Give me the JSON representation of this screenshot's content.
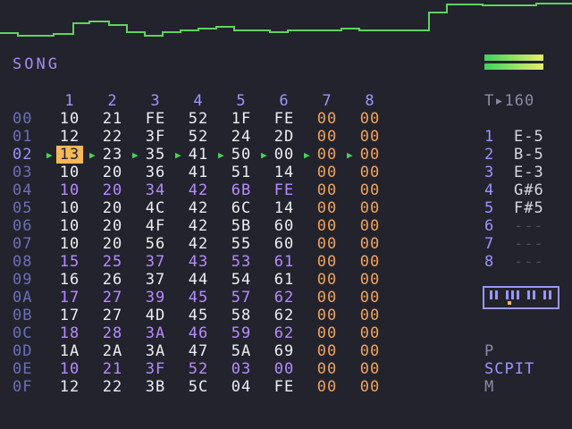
{
  "screen_title": "SONG",
  "columns": [
    "1",
    "2",
    "3",
    "4",
    "5",
    "6",
    "7",
    "8"
  ],
  "rows": [
    {
      "num": "00",
      "cells": [
        "10",
        "21",
        "FE",
        "52",
        "1F",
        "FE",
        "00",
        "00"
      ],
      "color": "white"
    },
    {
      "num": "01",
      "cells": [
        "12",
        "22",
        "3F",
        "52",
        "24",
        "2D",
        "00",
        "00"
      ],
      "color": "white"
    },
    {
      "num": "02",
      "cells": [
        "13",
        "23",
        "35",
        "41",
        "50",
        "00",
        "00",
        "00"
      ],
      "color": "white",
      "playing": true,
      "cursor": 0
    },
    {
      "num": "03",
      "cells": [
        "10",
        "20",
        "36",
        "41",
        "51",
        "14",
        "00",
        "00"
      ],
      "color": "white"
    },
    {
      "num": "04",
      "cells": [
        "10",
        "20",
        "34",
        "42",
        "6B",
        "FE",
        "00",
        "00"
      ],
      "color": "purple"
    },
    {
      "num": "05",
      "cells": [
        "10",
        "20",
        "4C",
        "42",
        "6C",
        "14",
        "00",
        "00"
      ],
      "color": "white"
    },
    {
      "num": "06",
      "cells": [
        "10",
        "20",
        "4F",
        "42",
        "5B",
        "60",
        "00",
        "00"
      ],
      "color": "white"
    },
    {
      "num": "07",
      "cells": [
        "10",
        "20",
        "56",
        "42",
        "55",
        "60",
        "00",
        "00"
      ],
      "color": "white"
    },
    {
      "num": "08",
      "cells": [
        "15",
        "25",
        "37",
        "43",
        "53",
        "61",
        "00",
        "00"
      ],
      "color": "purple"
    },
    {
      "num": "09",
      "cells": [
        "16",
        "26",
        "37",
        "44",
        "54",
        "61",
        "00",
        "00"
      ],
      "color": "white"
    },
    {
      "num": "0A",
      "cells": [
        "17",
        "27",
        "39",
        "45",
        "57",
        "62",
        "00",
        "00"
      ],
      "color": "purple"
    },
    {
      "num": "0B",
      "cells": [
        "17",
        "27",
        "4D",
        "45",
        "58",
        "62",
        "00",
        "00"
      ],
      "color": "white"
    },
    {
      "num": "0C",
      "cells": [
        "18",
        "28",
        "3A",
        "46",
        "59",
        "62",
        "00",
        "00"
      ],
      "color": "purple"
    },
    {
      "num": "0D",
      "cells": [
        "1A",
        "2A",
        "3A",
        "47",
        "5A",
        "69",
        "00",
        "00"
      ],
      "color": "white"
    },
    {
      "num": "0E",
      "cells": [
        "10",
        "21",
        "3F",
        "52",
        "03",
        "00",
        "00",
        "00"
      ],
      "color": "purple"
    },
    {
      "num": "0F",
      "cells": [
        "12",
        "22",
        "3B",
        "5C",
        "04",
        "FE",
        "00",
        "00"
      ],
      "color": "white"
    }
  ],
  "tempo": "T▸160",
  "tracks": [
    {
      "num": "1",
      "note": "E-5"
    },
    {
      "num": "2",
      "note": "B-5"
    },
    {
      "num": "3",
      "note": "E-3"
    },
    {
      "num": "4",
      "note": "G#6"
    },
    {
      "num": "5",
      "note": "F#5"
    },
    {
      "num": "6",
      "note": "---"
    },
    {
      "num": "7",
      "note": "---"
    },
    {
      "num": "8",
      "note": "---"
    }
  ],
  "menu": [
    "P",
    "SCPIT",
    "M"
  ],
  "colors": {
    "background": "#23232d",
    "scope": "#5fd35f",
    "selected_cell": "#f6b85a",
    "play_arrow": "#49d25b",
    "purple": "#b58cff",
    "orange": "#f0a45c"
  }
}
